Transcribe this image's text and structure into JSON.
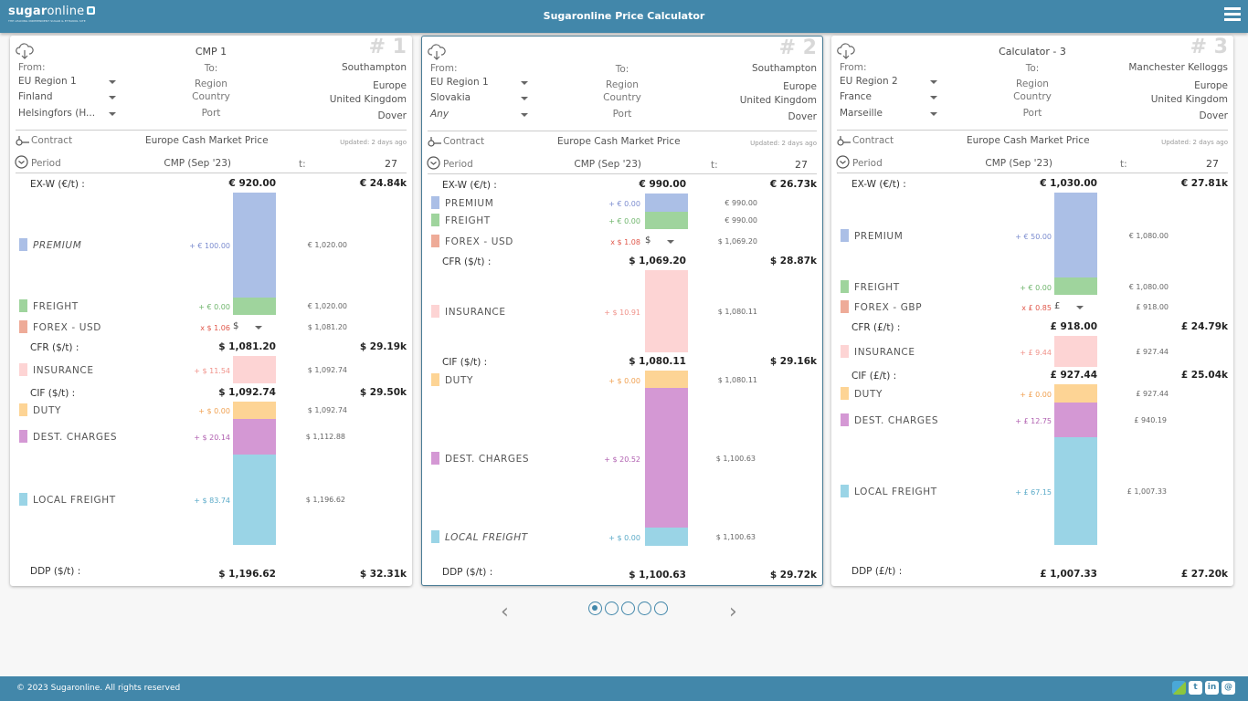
{
  "header": {
    "logo_main": "sugar",
    "logo_light": "online",
    "logo_tagline": "THE LEADING INDEPENDENT SUGAR & ETHANOL SITE",
    "title": "Sugaronline Price Calculator",
    "menu_icon": "hamburger-menu-icon"
  },
  "colors": {
    "brand": "#4287aa",
    "premium": "#abbfe6",
    "freight": "#9fd49d",
    "forex": "#eeab98",
    "insurance": "#fdd4d4",
    "duty": "#fdd495",
    "dest_charges": "#d498d4",
    "local_freight": "#9ad4e6"
  },
  "labels": {
    "from": "From:",
    "to": "To:",
    "region": "Region",
    "country": "Country",
    "port": "Port",
    "contract": "Contract",
    "period": "Period",
    "t": "t:"
  },
  "cards": [
    {
      "number": "# 1",
      "title": "CMP 1",
      "from": {
        "region": "EU Region 1",
        "country": "Finland",
        "port": "Helsingfors (H..."
      },
      "to": {
        "destination": "Southampton",
        "region": "Europe",
        "country": "United Kingdom",
        "port": "Dover"
      },
      "contract": "Europe Cash Market Price",
      "updated": "Updated: 2 days ago",
      "period": "CMP (Sep '23)",
      "tonnes": "27",
      "exw": {
        "label": "EX-W (€/t) :",
        "value": "€ 920.00",
        "total": "€ 24.84k"
      },
      "premium": {
        "label": "PREMIUM",
        "delta": "+ € 100.00",
        "cum": "€ 1,020.00",
        "amount": 100
      },
      "freight": {
        "label": "FREIGHT",
        "delta": "+ € 0.00",
        "cum": "€ 1,020.00",
        "amount": 0
      },
      "forex": {
        "label": "FOREX - USD",
        "delta": "x $ 1.06",
        "currency": "$",
        "cum": "$ 1,081.20"
      },
      "cfr": {
        "label": "CFR ($/t) :",
        "value": "$ 1,081.20",
        "total": "$ 29.19k"
      },
      "insurance": {
        "label": "INSURANCE",
        "delta": "+ $ 11.54",
        "cum": "$ 1,092.74",
        "amount": 11.54
      },
      "cif": {
        "label": "CIF ($/t) :",
        "value": "$ 1,092.74",
        "total": "$ 29.50k"
      },
      "duty": {
        "label": "DUTY",
        "delta": "+ $ 0.00",
        "cum": "$ 1,092.74",
        "amount": 0
      },
      "dest": {
        "label": "DEST. CHARGES",
        "delta": "+ $ 20.14",
        "cum": "$ 1,112.88",
        "amount": 20.14
      },
      "local": {
        "label": "LOCAL FREIGHT",
        "delta": "+ $ 83.74",
        "cum": "$ 1,196.62",
        "amount": 83.74
      },
      "ddp": {
        "label": "DDP ($/t) :",
        "value": "$ 1,196.62",
        "total": "$ 32.31k"
      }
    },
    {
      "number": "# 2",
      "title": "",
      "from": {
        "region": "EU Region 1",
        "country": "Slovakia",
        "port": "Any"
      },
      "to": {
        "destination": "Southampton",
        "region": "Europe",
        "country": "United Kingdom",
        "port": "Dover"
      },
      "contract": "Europe Cash Market Price",
      "updated": "Updated: 2 days ago",
      "period": "CMP (Sep '23)",
      "tonnes": "27",
      "exw": {
        "label": "EX-W (€/t) :",
        "value": "€ 990.00",
        "total": "€ 26.73k"
      },
      "premium": {
        "label": "PREMIUM",
        "delta": "+ € 0.00",
        "cum": "€ 990.00",
        "amount": 0
      },
      "freight": {
        "label": "FREIGHT",
        "delta": "+ € 0.00",
        "cum": "€ 990.00",
        "amount": 0
      },
      "forex": {
        "label": "FOREX - USD",
        "delta": "x $ 1.08",
        "currency": "$",
        "cum": "$ 1,069.20"
      },
      "cfr": {
        "label": "CFR ($/t) :",
        "value": "$ 1,069.20",
        "total": "$ 28.87k"
      },
      "insurance": {
        "label": "INSURANCE",
        "delta": "+ $ 10.91",
        "cum": "$ 1,080.11",
        "amount": 10.91
      },
      "cif": {
        "label": "CIF ($/t) :",
        "value": "$ 1,080.11",
        "total": "$ 29.16k"
      },
      "duty": {
        "label": "DUTY",
        "delta": "+ $ 0.00",
        "cum": "$ 1,080.11",
        "amount": 0
      },
      "dest": {
        "label": "DEST. CHARGES",
        "delta": "+ $ 20.52",
        "cum": "$ 1,100.63",
        "amount": 20.52
      },
      "local": {
        "label": "LOCAL FREIGHT",
        "delta": "+ $ 0.00",
        "cum": "$ 1,100.63",
        "amount": 0
      },
      "ddp": {
        "label": "DDP ($/t) :",
        "value": "$ 1,100.63",
        "total": "$ 29.72k"
      }
    },
    {
      "number": "# 3",
      "title": "Calculator - 3",
      "from": {
        "region": "EU Region 2",
        "country": "France",
        "port": "Marseille"
      },
      "to": {
        "destination": "Manchester Kelloggs",
        "region": "Europe",
        "country": "United Kingdom",
        "port": "Dover"
      },
      "contract": "Europe Cash Market Price",
      "updated": "Updated: 2 days ago",
      "period": "CMP (Sep '23)",
      "tonnes": "27",
      "exw": {
        "label": "EX-W (€/t) :",
        "value": "€ 1,030.00",
        "total": "€ 27.81k"
      },
      "premium": {
        "label": "PREMIUM",
        "delta": "+ € 50.00",
        "cum": "€ 1,080.00",
        "amount": 50
      },
      "freight": {
        "label": "FREIGHT",
        "delta": "+ € 0.00",
        "cum": "€ 1,080.00",
        "amount": 0
      },
      "forex": {
        "label": "FOREX - GBP",
        "delta": "x £ 0.85",
        "currency": "£",
        "cum": "£ 918.00"
      },
      "cfr": {
        "label": "CFR (£/t) :",
        "value": "£ 918.00",
        "total": "£ 24.79k"
      },
      "insurance": {
        "label": "INSURANCE",
        "delta": "+ £ 9.44",
        "cum": "£ 927.44",
        "amount": 9.44
      },
      "cif": {
        "label": "CIF (£/t) :",
        "value": "£ 927.44",
        "total": "£ 25.04k"
      },
      "duty": {
        "label": "DUTY",
        "delta": "+ £ 0.00",
        "cum": "£ 927.44",
        "amount": 0
      },
      "dest": {
        "label": "DEST. CHARGES",
        "delta": "+ £ 12.75",
        "cum": "£ 940.19",
        "amount": 12.75
      },
      "local": {
        "label": "LOCAL FREIGHT",
        "delta": "+ £ 67.15",
        "cum": "£ 1,007.33",
        "amount": 67.15
      },
      "ddp": {
        "label": "DDP (£/t) :",
        "value": "£ 1,007.33",
        "total": "£ 27.20k"
      }
    }
  ],
  "pager": {
    "prev_icon": "‹",
    "next_icon": "›",
    "pages": 5,
    "current": 1
  },
  "footer": {
    "copyright": "© 2023 Sugaronline. All rights reserved",
    "social": [
      {
        "name": "sugaronline",
        "glyph": ""
      },
      {
        "name": "twitter",
        "glyph": "t"
      },
      {
        "name": "linkedin",
        "glyph": "in"
      },
      {
        "name": "email",
        "glyph": "@"
      }
    ]
  }
}
